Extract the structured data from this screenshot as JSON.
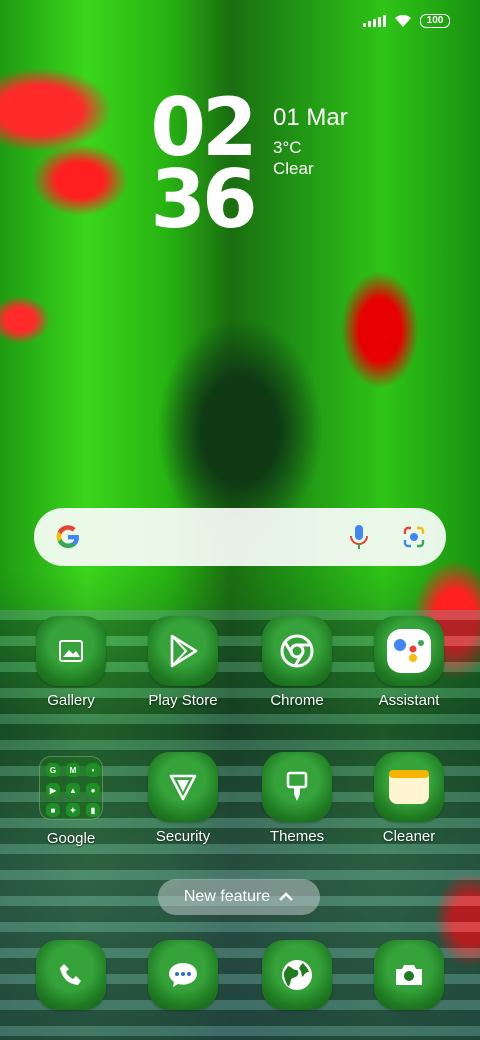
{
  "status_bar": {
    "battery": "100"
  },
  "clock": {
    "hour": "02",
    "minute": "36"
  },
  "date_widget": {
    "date": "01 Mar",
    "temperature": "3°C",
    "condition": "Clear"
  },
  "search": {
    "logo": "google-logo",
    "mic_icon": "mic-icon",
    "lens_icon": "lens-icon"
  },
  "apps_row1": [
    {
      "label": "Gallery",
      "icon": "gallery-icon"
    },
    {
      "label": "Play Store",
      "icon": "play-store-icon"
    },
    {
      "label": "Chrome",
      "icon": "chrome-icon"
    },
    {
      "label": "Assistant",
      "icon": "assistant-icon"
    }
  ],
  "apps_row2": [
    {
      "label": "Google",
      "icon": "folder-icon"
    },
    {
      "label": "Security",
      "icon": "security-icon"
    },
    {
      "label": "Themes",
      "icon": "themes-icon"
    },
    {
      "label": "Cleaner",
      "icon": "cleaner-icon"
    }
  ],
  "new_feature": {
    "label": "New feature"
  },
  "dock": [
    {
      "icon": "phone-icon"
    },
    {
      "icon": "messages-icon"
    },
    {
      "icon": "browser-icon"
    },
    {
      "icon": "camera-icon"
    }
  ],
  "colors": {
    "icon_green": "#1f7a22",
    "accent_red": "#ff2a2a"
  }
}
